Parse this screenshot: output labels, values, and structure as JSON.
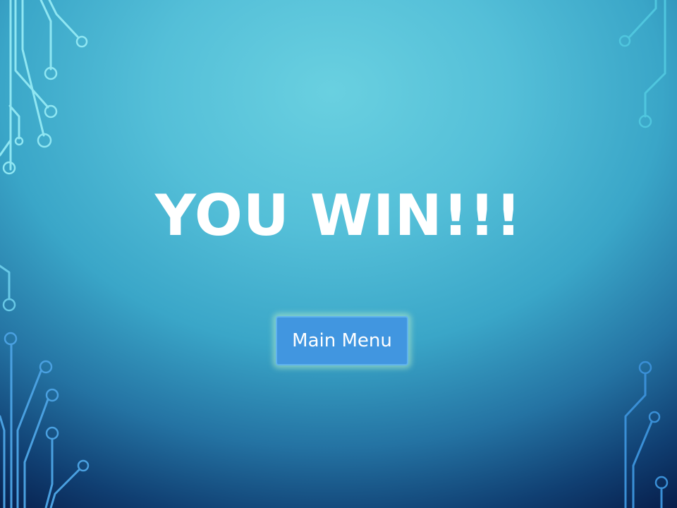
{
  "screen": {
    "title": "YOU WIN!!!",
    "main_menu_label": "Main Menu"
  },
  "icons": {
    "decorations": [
      "circuit-board-icon"
    ]
  },
  "colors": {
    "button_fill": "#4196e0",
    "title_text": "#ffffff",
    "circuit_trace_light": "#8fe6f2",
    "circuit_trace_dark": "#3a8fd6"
  }
}
